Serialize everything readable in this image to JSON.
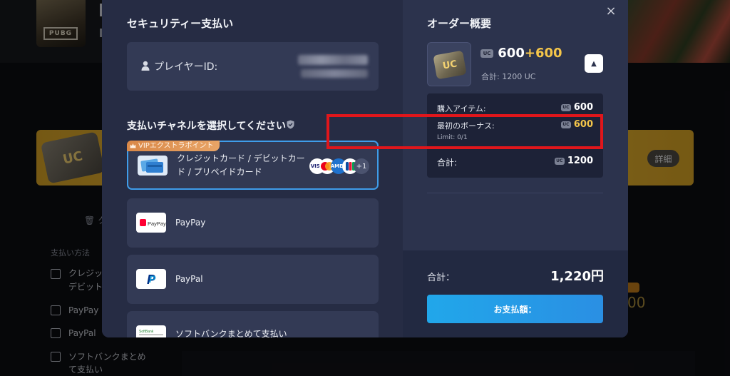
{
  "background": {
    "game_logo_text": "PUBG",
    "banner_badge": "UC",
    "details_button": "詳細",
    "trash_fragment": "ク",
    "payment_method_label": "支払い方法",
    "payment_options": [
      "クレジッ",
      "デビット",
      "PayPay",
      "PayPal",
      "ソフトバンクまとめ",
      "て支払い"
    ],
    "sale_fragment": "00"
  },
  "modal": {
    "left": {
      "title": "セキュリティー支払い",
      "player_label": "プレイヤーID:",
      "channel_title": "支払いチャネルを選択してください",
      "channels": [
        {
          "name_line1": "クレジットカード / デビットカー",
          "name_line2": "ド / プリペイドカード",
          "vip_badge": "VIPエクストラポイント",
          "brands": [
            "VISA",
            "MC",
            "AMEX",
            "JCB"
          ],
          "more": "+1",
          "selected": true
        },
        {
          "name": "PayPay",
          "icon_label": "PayPay",
          "icon": "paypay-icon"
        },
        {
          "name": "PayPal",
          "icon_label": "P",
          "icon": "paypal-icon"
        },
        {
          "name": "ソフトバンクまとめて支払い",
          "icon_label": "SoftBank",
          "icon": "softbank-icon"
        }
      ]
    },
    "right": {
      "close": "×",
      "title": "オーダー概要",
      "product_badge": "UC",
      "uc_badge": "UC",
      "uc_base": "600",
      "uc_plus": "+",
      "uc_bonus": "600",
      "total_uc_text": "合計: 1200 UC",
      "collapse_icon": "▲",
      "rows": [
        {
          "label": "購入アイテム:",
          "value": "600"
        },
        {
          "label": "最初のボーナス:",
          "value": "600",
          "note": "Limit: 0/1"
        },
        {
          "label": "合計:",
          "value": "1200"
        }
      ],
      "checkout": {
        "total_label": "合計：",
        "total_amount": "1,220円",
        "pay_button": "お支払額："
      }
    }
  },
  "colors": {
    "accent_blue": "#3f9dea",
    "bonus_gold": "#f5c64a",
    "highlight_red": "#e0161b"
  }
}
